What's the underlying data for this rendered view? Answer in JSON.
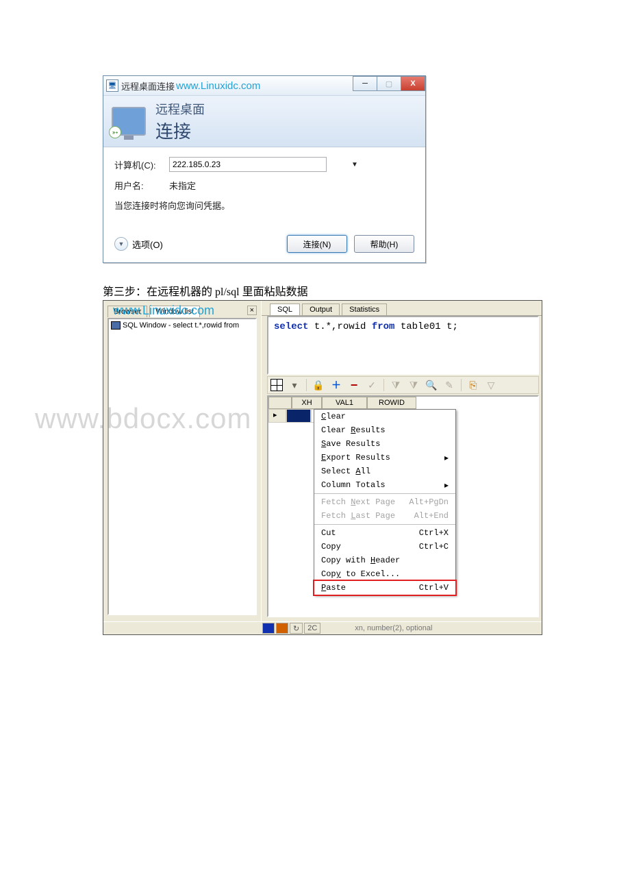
{
  "rdp": {
    "title": "远程桌面连接",
    "watermark": "www.Linuxidc.com",
    "header_small": "远程桌面",
    "header_big": "连接",
    "computer_label": "计算机(C):",
    "computer_value": "222.185.0.23",
    "user_label": "用户名:",
    "user_value": "未指定",
    "note": "当您连接时将向您询问凭据。",
    "options_label": "选项(O)",
    "connect_label": "连接(N)",
    "help_label": "帮助(H)"
  },
  "step_text": "第三步：在远程机器的 pl/sql 里面粘贴数据",
  "plsql": {
    "watermark": "www.Linuxidc.com",
    "big_watermark": "www.bdocx.com",
    "left_tabs": {
      "browser": "Browser",
      "window_list": "Window list"
    },
    "left_item": "SQL Window - select t.*,rowid from",
    "sql_tabs": {
      "sql": "SQL",
      "output": "Output",
      "stats": "Statistics"
    },
    "sql_text_pre": "select",
    "sql_text_mid_a": " t.*,rowid ",
    "sql_text_mid_b": "from",
    "sql_text_end": " table01 t;",
    "grid": {
      "xh": "XH",
      "val1": "VAL1",
      "rowid": "ROWID"
    },
    "ctx": {
      "clear": "Clear",
      "clear_results": "Clear Results",
      "save_results": "Save Results",
      "export_results": "Export Results",
      "select_all": "Select All",
      "column_totals": "Column Totals",
      "fetch_next": "Fetch Next Page",
      "fetch_next_k": "Alt+PgDn",
      "fetch_last": "Fetch Last Page",
      "fetch_last_k": "Alt+End",
      "cut": "Cut",
      "cut_k": "Ctrl+X",
      "copy": "Copy",
      "copy_k": "Ctrl+C",
      "copy_header": "Copy with Header",
      "copy_excel": "Copy to Excel...",
      "paste": "Paste",
      "paste_k": "Ctrl+V"
    },
    "status_2c": "2C",
    "status_hint": "xn, number(2), optional"
  }
}
